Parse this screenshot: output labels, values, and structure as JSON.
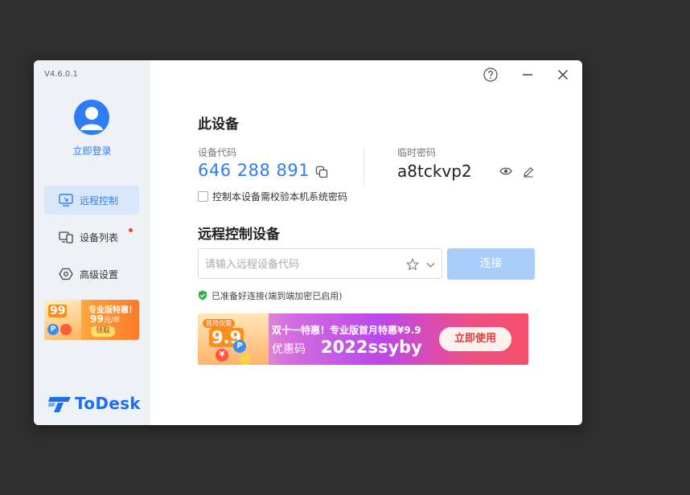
{
  "app": {
    "version": "V4.6.0.1",
    "logo_text": "ToDesk"
  },
  "sidebar": {
    "login_label": "立即登录",
    "items": [
      {
        "label": "远程控制",
        "active": true
      },
      {
        "label": "设备列表",
        "active": false,
        "has_dot": true
      },
      {
        "label": "高级设置",
        "active": false
      }
    ],
    "promo": {
      "badge": "99",
      "title": "专业版特惠！",
      "price": "99",
      "unit": "元/年",
      "button": "领取"
    }
  },
  "this_device": {
    "title": "此设备",
    "code_label": "设备代码",
    "code": "646 288 891",
    "temp_password_label": "临时密码",
    "temp_password": "a8tckvp2",
    "verify_checkbox_label": "控制本设备需校验本机系统密码",
    "verify_checked": false
  },
  "remote_control": {
    "title": "远程控制设备",
    "input_placeholder": "请输入远程设备代码",
    "connect_label": "连接",
    "status_text": "已准备好连接(端到端加密已启用)"
  },
  "banner": {
    "tag": "首月仅需",
    "badge": "9.9",
    "line1": "双十一特惠！专业版首月特惠¥9.9",
    "coupon_label": "优惠码",
    "coupon_code": "2022ssyby",
    "button": "立即使用"
  },
  "colors": {
    "accent": "#2f7df6",
    "connect_button": "#a9cdfb",
    "sidebar_bg": "#eef1f5",
    "status_ok": "#2fb344"
  },
  "icons": [
    "help-icon",
    "minimize-icon",
    "close-icon",
    "user-icon",
    "monitor-icon",
    "devices-icon",
    "settings-icon",
    "copy-icon",
    "eye-icon",
    "edit-icon",
    "star-icon",
    "chevron-down-icon",
    "shield-check-icon"
  ]
}
